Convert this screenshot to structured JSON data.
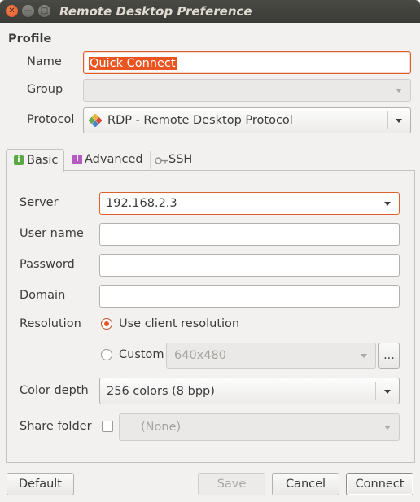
{
  "window": {
    "title": "Remote Desktop Preference"
  },
  "profile": {
    "heading": "Profile",
    "name_label": "Name",
    "name_value": "Quick Connect",
    "group_label": "Group",
    "group_value": "",
    "protocol_label": "Protocol",
    "protocol_value": "RDP - Remote Desktop Protocol"
  },
  "tabs": [
    {
      "label": "Basic",
      "icon": "info-icon",
      "active": true
    },
    {
      "label": "Advanced",
      "icon": "warning-icon",
      "active": false
    },
    {
      "label": "SSH",
      "icon": "key-icon",
      "active": false
    }
  ],
  "basic": {
    "server_label": "Server",
    "server_value": "192.168.2.3",
    "username_label": "User name",
    "username_value": "",
    "password_label": "Password",
    "password_value": "",
    "domain_label": "Domain",
    "domain_value": "",
    "resolution_label": "Resolution",
    "resolution_client": "Use client resolution",
    "resolution_custom": "Custom",
    "resolution_custom_value": "640x480",
    "resolution_more": "...",
    "color_label": "Color depth",
    "color_value": "256 colors (8 bpp)",
    "share_label": "Share folder",
    "share_value": "(None)"
  },
  "buttons": {
    "default": "Default",
    "save": "Save",
    "cancel": "Cancel",
    "connect": "Connect"
  },
  "colors": {
    "accent": "#e95420",
    "titlebar": "#3c3b37",
    "background": "#f2f1f0"
  }
}
